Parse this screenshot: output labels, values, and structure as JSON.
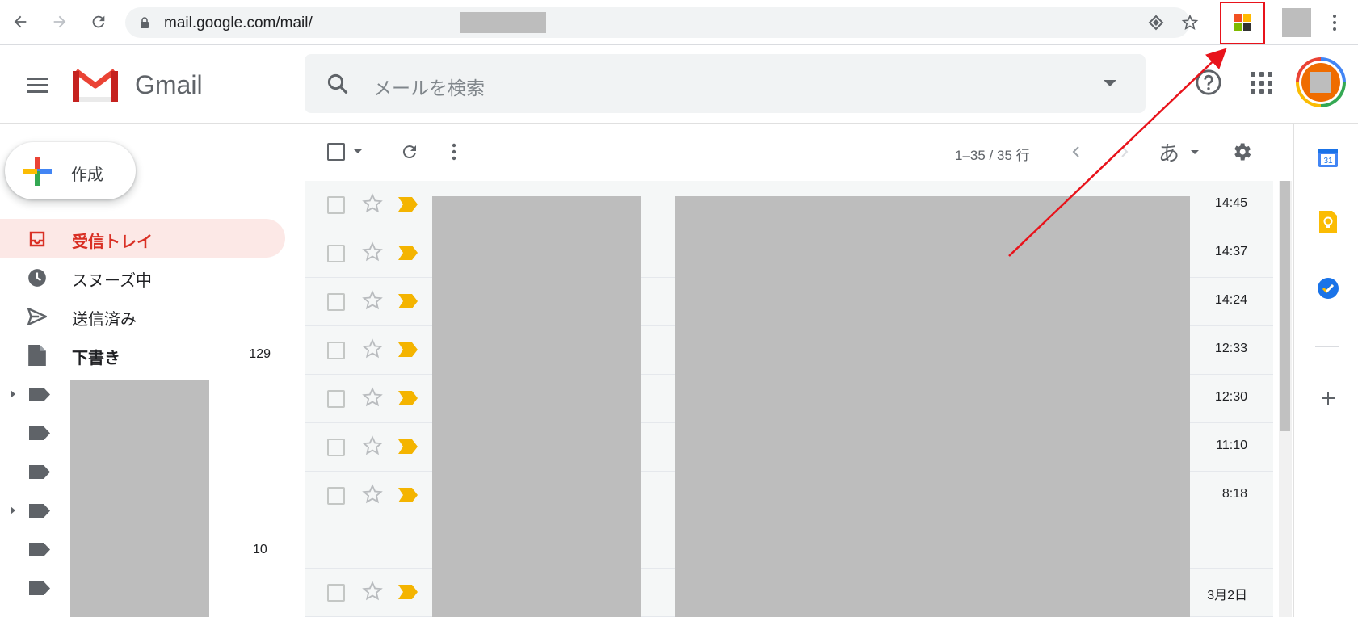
{
  "browser": {
    "url": "mail.google.com/mail/"
  },
  "gmail": {
    "brand": "Gmail",
    "search_placeholder": "メールを検索",
    "compose_label": "作成"
  },
  "sidebar": {
    "items": [
      {
        "label": "受信トレイ",
        "count": ""
      },
      {
        "label": "スヌーズ中",
        "count": ""
      },
      {
        "label": "送信済み",
        "count": ""
      },
      {
        "label": "下書き",
        "count": "129"
      }
    ],
    "label_counts": [
      "10"
    ]
  },
  "toolbar": {
    "pager": "1–35 / 35 行",
    "ime_mode": "あ"
  },
  "emails": [
    {
      "time": "14:45"
    },
    {
      "time": "14:37"
    },
    {
      "time": "14:24"
    },
    {
      "time": "12:33"
    },
    {
      "time": "12:30"
    },
    {
      "time": "11:10"
    },
    {
      "time": "8:18"
    },
    {
      "time": "3月2日"
    }
  ],
  "side_panel": {
    "calendar_day": "31"
  },
  "colors": {
    "accent_red": "#d93025",
    "highlight_box": "#e8131b",
    "importance_yellow": "#f4b400",
    "redaction_gray": "#bdbdbd"
  },
  "icons": [
    "back-arrow-icon",
    "forward-arrow-icon",
    "reload-icon",
    "lock-icon",
    "install-app-icon",
    "bookmark-star-icon",
    "extension-icon",
    "menu-icon",
    "gmail-logo-icon",
    "search-icon",
    "help-icon",
    "apps-grid-icon",
    "inbox-icon",
    "clock-icon",
    "send-icon",
    "draft-icon",
    "label-icon",
    "refresh-icon",
    "more-icon",
    "settings-gear-icon",
    "star-icon",
    "importance-marker-icon",
    "calendar-icon",
    "keep-icon",
    "tasks-icon",
    "add-icon"
  ]
}
